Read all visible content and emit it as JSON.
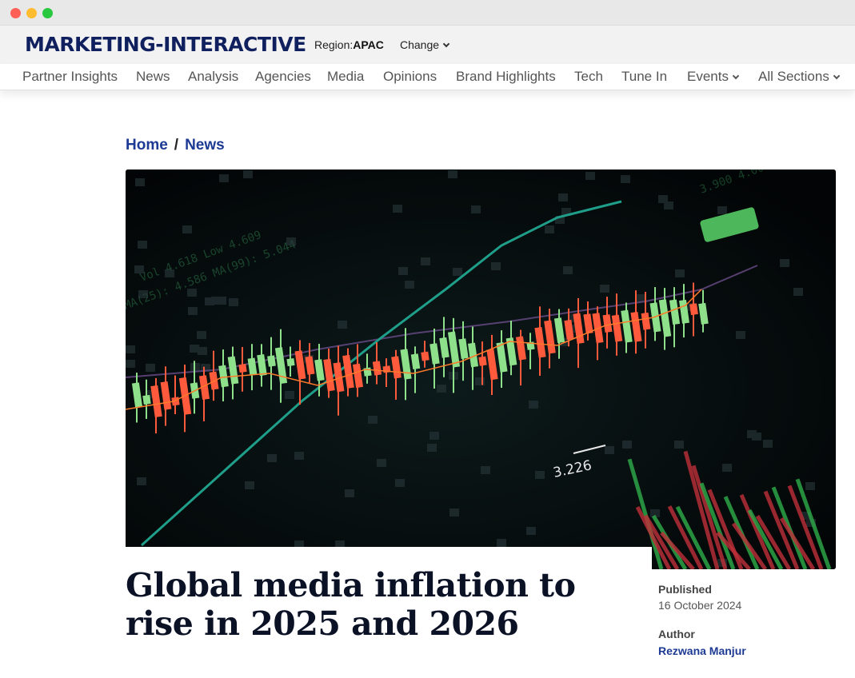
{
  "site": {
    "logo": "MARKETING-INTERACTIVE",
    "region_label": "Region:",
    "region_value": "APAC",
    "change_label": "Change"
  },
  "nav": {
    "items": [
      "Partner Insights",
      "News",
      "Analysis",
      "Agencies",
      "Media",
      "Opinions",
      "Brand Highlights",
      "Tech",
      "Tune In",
      "Events",
      "All Sections"
    ]
  },
  "breadcrumb": {
    "home": "Home",
    "separator": "/",
    "current": "News"
  },
  "hero": {
    "price_label": "3.226",
    "icon": "stock-candlestick-photo",
    "colors": {
      "up": "#8ee08a",
      "down": "#ff5a3c",
      "trend": "#1f9e8a",
      "background": "#05090b"
    }
  },
  "article": {
    "headline": "Global media inflation to rise in 2025 and 2026",
    "published_label": "Published",
    "published_date": "16 October 2024",
    "author_label": "Author",
    "author_name": "Rezwana Manjur"
  }
}
